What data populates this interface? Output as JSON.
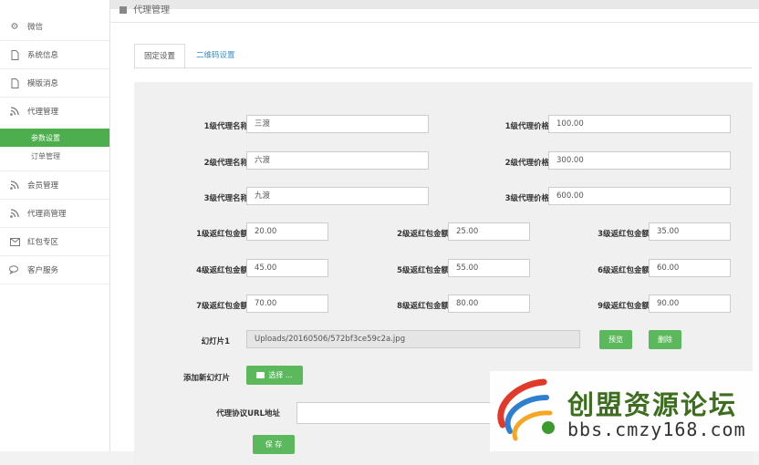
{
  "sidebar": {
    "items": [
      {
        "label": "微信",
        "icon": "gears-icon"
      },
      {
        "label": "系统信息",
        "icon": "file-icon"
      },
      {
        "label": "模版消息",
        "icon": "file-icon"
      },
      {
        "label": "代理管理",
        "icon": "rss-icon"
      }
    ],
    "sub_items": [
      {
        "label": "参数设置",
        "active": true
      },
      {
        "label": "订单管理",
        "active": false
      }
    ],
    "items_after": [
      {
        "label": "会员管理",
        "icon": "rss-icon"
      },
      {
        "label": "代理商管理",
        "icon": "rss-icon"
      },
      {
        "label": "红包专区",
        "icon": "envelope-icon"
      },
      {
        "label": "客户服务",
        "icon": "chat-icon"
      }
    ]
  },
  "header": {
    "title": "代理管理"
  },
  "tabs": [
    {
      "label": "固定设置",
      "active": true
    },
    {
      "label": "二维码设置",
      "active": false
    }
  ],
  "form": {
    "agent_names": [
      {
        "label": "1级代理名称",
        "value": "三渡"
      },
      {
        "label": "2级代理名称",
        "value": "六渡"
      },
      {
        "label": "3级代理名称",
        "value": "九渡"
      }
    ],
    "agent_prices": [
      {
        "label": "1级代理价格",
        "value": "100.00"
      },
      {
        "label": "2级代理价格",
        "value": "300.00"
      },
      {
        "label": "3级代理价格",
        "value": "600.00"
      }
    ],
    "rebates": [
      {
        "label": "1级返红包金额",
        "value": "20.00"
      },
      {
        "label": "2级返红包金额",
        "value": "25.00"
      },
      {
        "label": "3级返红包金额",
        "value": "35.00"
      },
      {
        "label": "4级返红包金额",
        "value": "45.00"
      },
      {
        "label": "5级返红包金额",
        "value": "55.00"
      },
      {
        "label": "6级返红包金额",
        "value": "60.00"
      },
      {
        "label": "7级返红包金额",
        "value": "70.00"
      },
      {
        "label": "8级返红包金额",
        "value": "80.00"
      },
      {
        "label": "9级返红包金额",
        "value": "90.00"
      }
    ],
    "slide": {
      "label": "幻灯片1",
      "value": "Uploads/20160506/572bf3ce59c2a.jpg",
      "preview_label": "预览",
      "delete_label": "删除"
    },
    "add_slide": {
      "label": "添加新幻灯片",
      "button_label": "选择 ..."
    },
    "url": {
      "label": "代理协议URL地址",
      "value": ""
    },
    "save_label": "保 存"
  },
  "watermark": {
    "title": "创盟资源论坛",
    "url": "bbs.cmzy168.com"
  },
  "colors": {
    "accent": "#5cb85c",
    "link": "#3a8ec2"
  }
}
